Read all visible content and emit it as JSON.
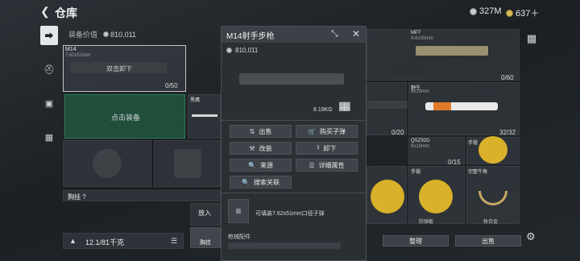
{
  "header": {
    "title": "仓库",
    "silver": "327M",
    "gold": "637＋"
  },
  "equipment": {
    "value_label": "装备价值",
    "value": "810,011",
    "slot1": {
      "name": "M14",
      "caliber": "7.62x51mm",
      "hint": "双击卸下",
      "ammo": "0/50"
    },
    "slot2_hint": "点击装备",
    "melee_name": "黑鹰",
    "chest_rig": "胸挂 ?",
    "put_in": "放入",
    "chest_rig_btn": "胸挂",
    "weight": "12.1/81千克"
  },
  "popup": {
    "title": "M14射手步枪",
    "price": "810,011",
    "weight": "8.19KG",
    "actions": [
      "出售",
      "购买子弹",
      "改装",
      "卸下",
      "来源",
      "详细属性",
      "搜索关联"
    ],
    "ammo_text": "可填装7.62x51mm口径子弹",
    "attachments": "枪械配件"
  },
  "storage": {
    "mp7": {
      "name": "MP7",
      "caliber": "4.6x30mm",
      "count": "0/60"
    },
    "rifle_count": "0/20",
    "yeniu": {
      "name": "野牛",
      "caliber": "9x19mm",
      "count": "32/32"
    },
    "qsz": {
      "name": "QSZ92G",
      "caliber": "9x19mm",
      "count": "0/15"
    },
    "saw_label": "手锯",
    "saw_sub": "防弹板",
    "horn_name": "完整牛角",
    "horn_sub": "牧合金",
    "sort": "整理",
    "sell": "出售"
  }
}
